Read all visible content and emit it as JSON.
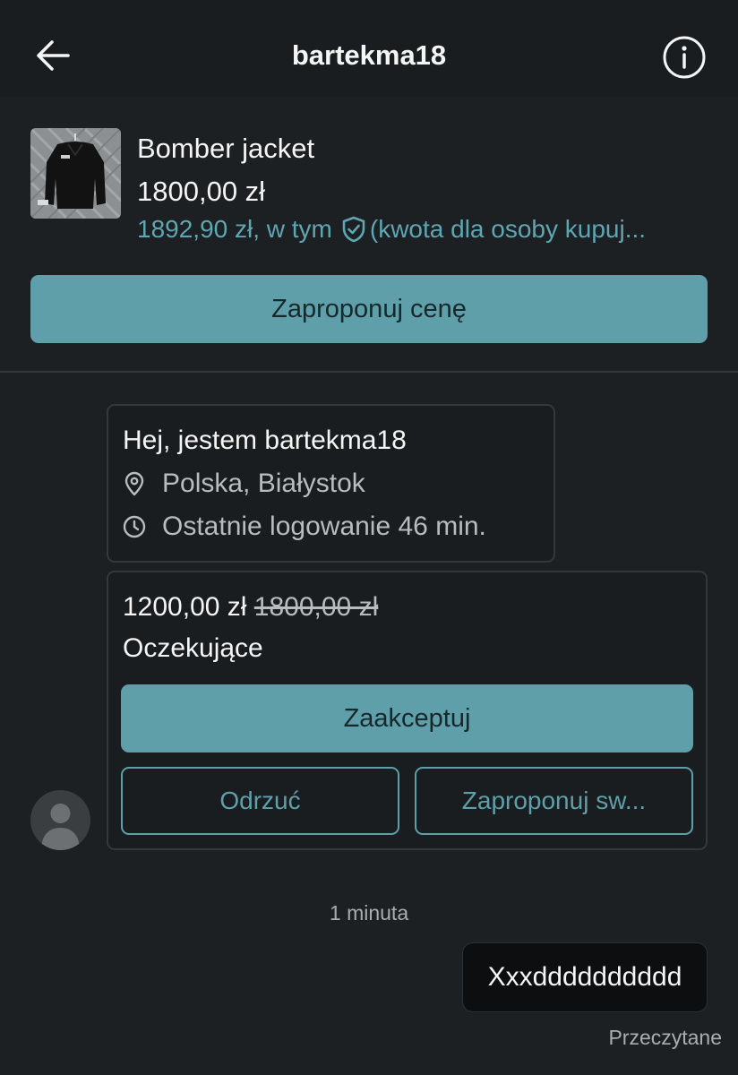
{
  "header": {
    "title": "bartekma18",
    "back_icon": "arrow-left-icon",
    "info_icon": "info-icon"
  },
  "item": {
    "title": "Bomber jacket",
    "price": "1800,00 zł",
    "total_prefix": "1892,90 zł, w tym",
    "total_suffix": "(kwota dla osoby kupuj...",
    "shield_icon": "shield-check-icon"
  },
  "offer_button": {
    "label": "Zaproponuj cenę"
  },
  "intro": {
    "title": "Hej, jestem bartekma18",
    "location": "Polska, Białystok",
    "last_login": "Ostatnie logowanie 46 min.",
    "location_icon": "location-pin-icon",
    "clock_icon": "clock-icon"
  },
  "offer": {
    "new_price": "1200,00 zł",
    "old_price": "1800,00 zł",
    "status": "Oczekujące",
    "accept_label": "Zaakceptuj",
    "reject_label": "Odrzuć",
    "counter_label": "Zaproponuj sw..."
  },
  "chat": {
    "timestamp": "1 minuta",
    "message": "Xxxdddddddddd",
    "read_status": "Przeczytane"
  },
  "colors": {
    "background": "#1d2022",
    "accent": "#5e9fa9",
    "link": "#5ea6b2"
  }
}
